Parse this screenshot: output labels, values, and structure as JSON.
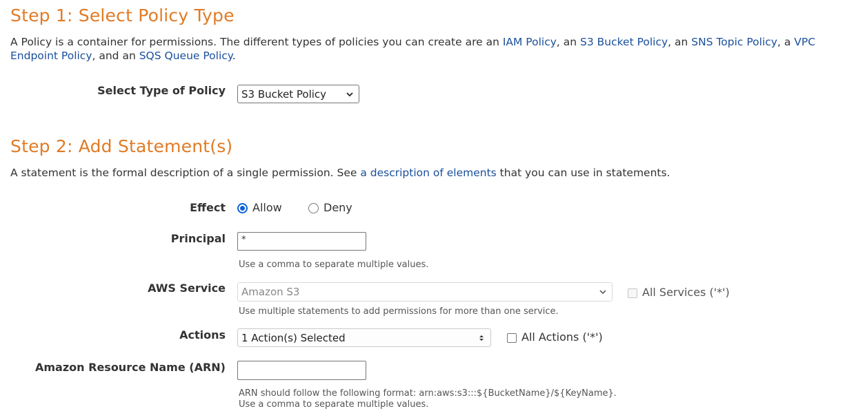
{
  "step1": {
    "heading": "Step 1: Select Policy Type",
    "desc_parts": {
      "t1": "A Policy is a container for permissions. The different types of policies you can create are an ",
      "l1": "IAM Policy",
      "t2": ", an ",
      "l2": "S3 Bucket Policy",
      "t3": ", an ",
      "l3": "SNS Topic Policy",
      "t4": ", a ",
      "l4": "VPC Endpoint Policy",
      "t5": ", and an ",
      "l5": "SQS Queue Policy",
      "t6": "."
    },
    "policy_type_label": "Select Type of Policy",
    "policy_type_value": "S3 Bucket Policy"
  },
  "step2": {
    "heading": "Step 2: Add Statement(s)",
    "desc_parts": {
      "t1": "A statement is the formal description of a single permission. See ",
      "l1": "a description of elements",
      "t2": " that you can use in statements."
    },
    "effect": {
      "label": "Effect",
      "options": [
        "Allow",
        "Deny"
      ],
      "selected": "Allow"
    },
    "principal": {
      "label": "Principal",
      "value": "*",
      "hint": "Use a comma to separate multiple values."
    },
    "aws_service": {
      "label": "AWS Service",
      "value": "Amazon S3",
      "all_label": "All Services ('*')",
      "hint": "Use multiple statements to add permissions for more than one service."
    },
    "actions": {
      "label": "Actions",
      "value": "1 Action(s) Selected",
      "all_label": "All Actions ('*')"
    },
    "arn": {
      "label": "Amazon Resource Name (ARN)",
      "value": "",
      "hint1": "ARN should follow the following format: arn:aws:s3:::${BucketName}/${KeyName}.",
      "hint2": "Use a comma to separate multiple values."
    }
  },
  "icons": {
    "select_arrow": "chevron-down-icon",
    "updown_arrow": "updown-arrows-icon"
  },
  "colors": {
    "heading": "#e07b26",
    "link": "#1a4f9c",
    "radio_checked": "#0a63d6"
  }
}
